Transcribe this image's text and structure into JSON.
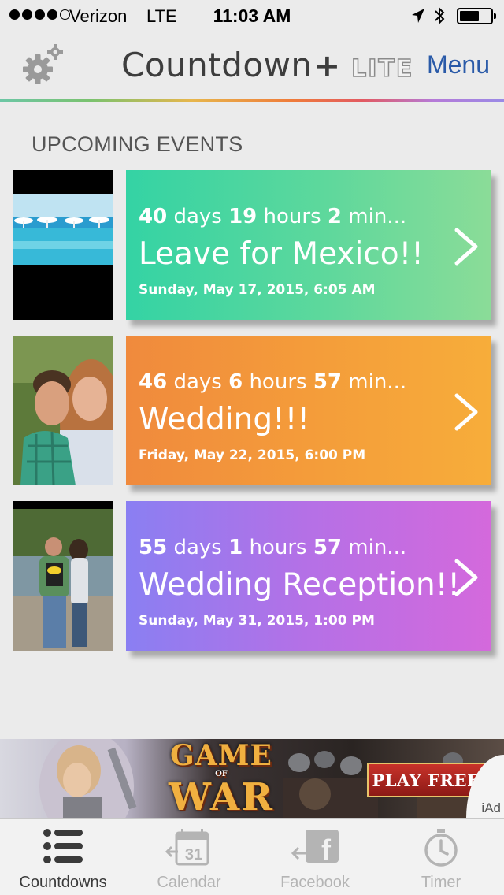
{
  "status_bar": {
    "carrier": "Verizon",
    "network": "LTE",
    "time": "11:03 AM",
    "signal_bars_filled": 4,
    "signal_bars_total": 5,
    "battery_level": 0.5
  },
  "nav": {
    "title": "Countdown",
    "title_plus": "+",
    "badge": "LITE",
    "menu_label": "Menu",
    "settings_icon": "gear-icon"
  },
  "section_title": "UPCOMING EVENTS",
  "events": [
    {
      "days": "40",
      "days_unit": "days",
      "hours": "19",
      "hours_unit": "hours",
      "mins": "2",
      "mins_unit": "min...",
      "name": "Leave for Mexico!!",
      "date": "Sunday, May 17, 2015, 6:05 AM",
      "color": "#34d3a4"
    },
    {
      "days": "46",
      "days_unit": "days",
      "hours": "6",
      "hours_unit": "hours",
      "mins": "57",
      "mins_unit": "min...",
      "name": "Wedding!!!",
      "date": "Friday, May 22, 2015, 6:00 PM",
      "color": "#f39238"
    },
    {
      "days": "55",
      "days_unit": "days",
      "hours": "1",
      "hours_unit": "hours",
      "mins": "57",
      "mins_unit": "min...",
      "name": "Wedding Reception!!",
      "date": "Sunday, May 31, 2015, 1:00 PM",
      "color": "#b570e6"
    }
  ],
  "ad": {
    "title_top": "GAME",
    "title_mid": "OF",
    "title_bottom": "WAR",
    "button": "PLAY FREE",
    "badge": "iAd"
  },
  "tabs": [
    {
      "label": "Countdowns",
      "icon": "list-icon",
      "active": true
    },
    {
      "label": "Calendar",
      "icon": "calendar-icon",
      "icon_text": "31",
      "active": false
    },
    {
      "label": "Facebook",
      "icon": "facebook-share-icon",
      "icon_text": "f",
      "active": false
    },
    {
      "label": "Timer",
      "icon": "stopwatch-icon",
      "active": false
    }
  ]
}
